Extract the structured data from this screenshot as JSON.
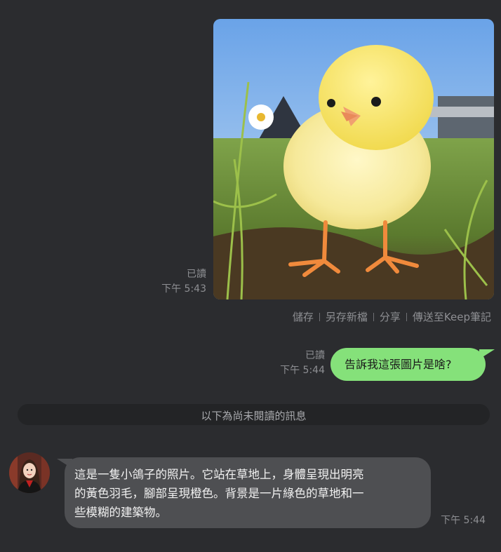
{
  "messages": {
    "image_message": {
      "read_status": "已讀",
      "time": "下午 5:43",
      "actions": [
        "儲存",
        "另存新檔",
        "分享",
        "傳送至Keep筆記"
      ]
    },
    "question_message": {
      "text": "告訴我這張圖片是啥?",
      "read_status": "已讀",
      "time": "下午 5:44"
    },
    "unread_divider": "以下為尚未閱讀的訊息",
    "reply_message": {
      "lines": [
        "這是一隻小鴿子的照片。它站在草地上，身體呈現出明亮",
        "的黃色羽毛，腳部呈現橙色。背景是一片綠色的草地和一",
        "些模糊的建築物。"
      ],
      "time": "下午 5:44"
    }
  },
  "colors": {
    "background": "#2b2c2f",
    "outgoing_bubble": "#85e17a",
    "incoming_bubble": "#4e4f52",
    "meta_text": "#8e8f93"
  }
}
